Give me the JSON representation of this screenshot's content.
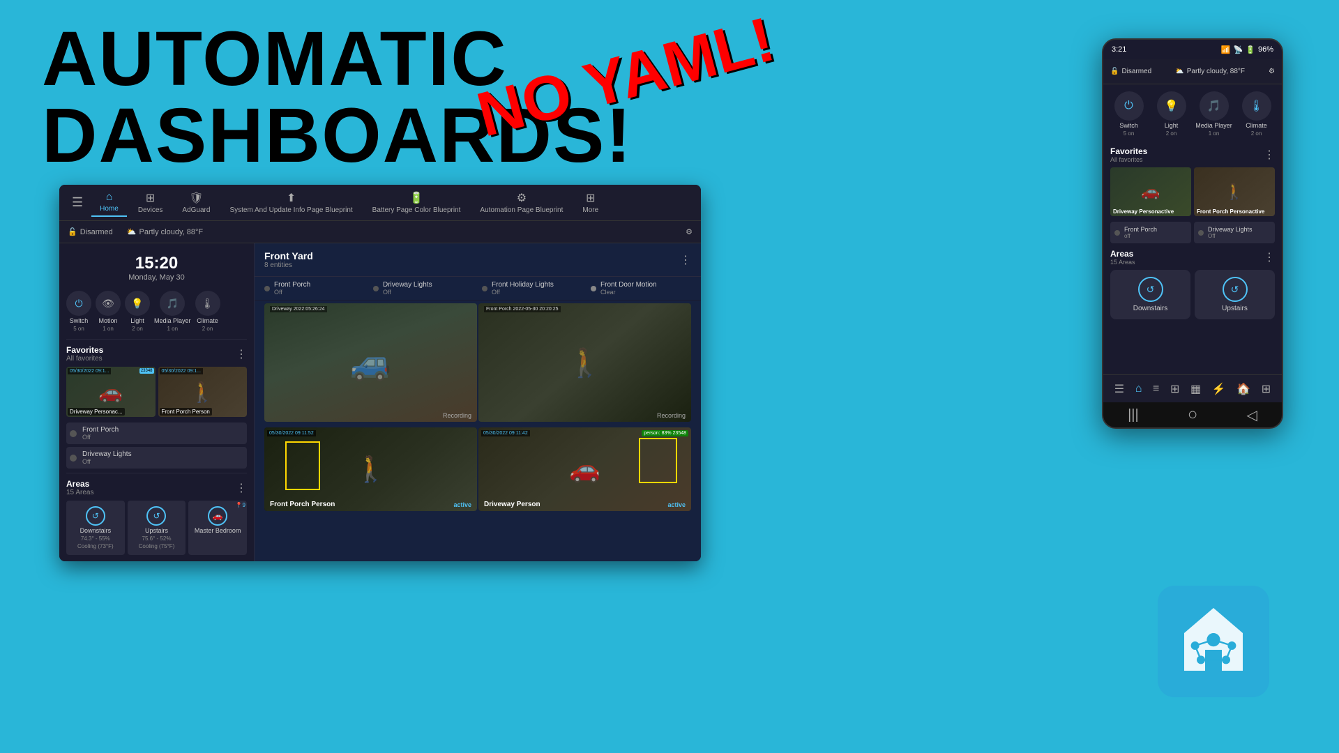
{
  "title": {
    "line1": "AUTOMATIC",
    "line2": "DASHBOARDS!",
    "no_yaml": "NO YAML!"
  },
  "dashboard": {
    "nav_items": [
      {
        "id": "home",
        "label": "Home",
        "icon": "⌂",
        "active": true
      },
      {
        "id": "devices",
        "label": "Devices",
        "icon": "⊞"
      },
      {
        "id": "adguard",
        "label": "AdGuard",
        "icon": "🛡"
      },
      {
        "id": "system",
        "label": "System And Update Info Page Blueprint",
        "icon": "⬆"
      },
      {
        "id": "battery",
        "label": "Battery Page Color Blueprint",
        "icon": "🔋"
      },
      {
        "id": "automation",
        "label": "Automation Page Blueprint",
        "icon": "⚙"
      },
      {
        "id": "more",
        "label": "More",
        "icon": "⊞"
      }
    ],
    "status": {
      "disarmed": "Disarmed",
      "weather": "Partly cloudy, 88°F"
    },
    "time": "15:20",
    "date": "Monday, May 30",
    "devices": [
      {
        "label": "Switch",
        "count": "5 on",
        "icon": "⏻",
        "active": true
      },
      {
        "label": "Motion",
        "count": "1 on",
        "icon": "👁",
        "active": false
      },
      {
        "label": "Light",
        "count": "2 on",
        "icon": "💡",
        "active": true
      },
      {
        "label": "Media Player",
        "count": "1 on",
        "icon": "🎵",
        "active": false
      },
      {
        "label": "Climate",
        "count": "2 on",
        "icon": "🌡",
        "active": false
      }
    ],
    "favorites": {
      "title": "Favorites",
      "subtitle": "All favorites",
      "cams": [
        {
          "label": "Driveway Personac...",
          "date": "05/30/2022 09:1..."
        },
        {
          "label": "Front Porch Person",
          "date": "05/30/2022 09:1..."
        }
      ],
      "lights": [
        {
          "name": "Front Porch",
          "status": "Off",
          "on": false
        },
        {
          "name": "Driveway Lights",
          "status": "Off",
          "on": false
        }
      ]
    },
    "areas": {
      "title": "Areas",
      "count": "15 Areas",
      "items": [
        {
          "name": "Downstairs",
          "icon": "↺",
          "temp": "74.3° - 55%",
          "cooling": "Cooling (73°F)"
        },
        {
          "name": "Upstairs",
          "icon": "↺",
          "temp": "75.6° - 52%",
          "cooling": "Cooling (75°F)"
        },
        {
          "name": "Master Bedroom",
          "icon": "🚗",
          "badge": "9"
        }
      ]
    },
    "front_yard": {
      "title": "Front Yard",
      "entities_count": "8 entities",
      "entities": [
        {
          "name": "Front Porch",
          "status": "Off",
          "on": false
        },
        {
          "name": "Driveway Lights",
          "status": "Off",
          "on": false
        },
        {
          "name": "Front Holiday Lights",
          "status": "Off",
          "on": false
        },
        {
          "name": "Front Door Motion",
          "status": "Clear",
          "on": false,
          "motion": true
        }
      ],
      "feeds": [
        {
          "label": "Driveway",
          "timestamp": "2022:05:26:24",
          "recording": "Recording"
        },
        {
          "label": "Front Porch",
          "timestamp": "2022-05-30 20:20:25",
          "recording": "Recording"
        }
      ],
      "clips": [
        {
          "label": "Front Porch Person",
          "status": "active",
          "timestamp": "05/30/2022 09:11:52"
        },
        {
          "label": "Driveway Person",
          "status": "active",
          "timestamp": "05/30/2022 09:11:42",
          "person_badge": "person: 83% 23548"
        }
      ]
    }
  },
  "phone": {
    "status_time": "3:21",
    "battery": "96%",
    "header": {
      "disarmed": "Disarmed",
      "weather": "Partly cloudy, 88°F"
    },
    "devices": [
      {
        "label": "Switch",
        "count": "5 on",
        "icon": "⏻"
      },
      {
        "label": "Light",
        "count": "2 on",
        "icon": "💡"
      },
      {
        "label": "Media Player",
        "count": "1 on",
        "icon": "🎵"
      },
      {
        "label": "Climate",
        "count": "2 on",
        "icon": "🌡"
      }
    ],
    "favorites": {
      "title": "Favorites",
      "subtitle": "All favorites",
      "cams": [
        {
          "label": "Driveway Personactive"
        },
        {
          "label": "Front Porch Personactive"
        }
      ],
      "lights": [
        {
          "name": "Front Porch",
          "status": "off",
          "on": false
        },
        {
          "name": "Driveway Lights",
          "status": "Off",
          "on": false
        }
      ]
    },
    "areas": {
      "title": "Areas",
      "count": "15 Areas",
      "items": [
        {
          "name": "Downstairs"
        },
        {
          "name": "Upstairs"
        }
      ]
    }
  }
}
